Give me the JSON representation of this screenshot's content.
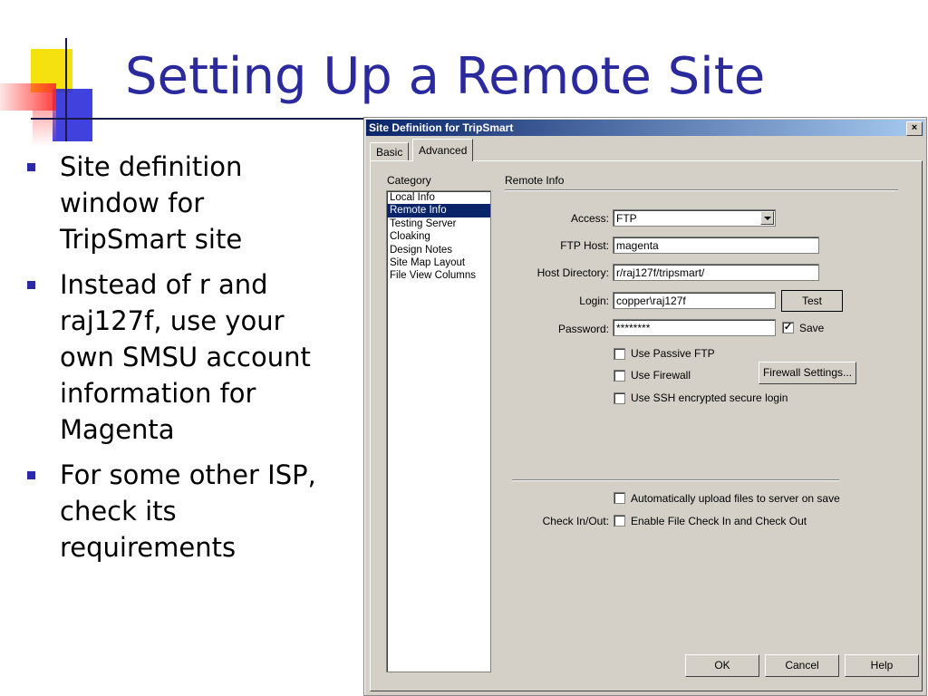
{
  "slide": {
    "title": "Setting Up a Remote Site",
    "bullets": [
      "Site definition window for TripSmart site",
      "Instead of r and raj127f, use your own SMSU account information for Magenta",
      "For some other ISP, check its requirements"
    ]
  },
  "dialog": {
    "title": "Site Definition for TripSmart",
    "close_label": "×",
    "tabs": [
      "Basic",
      "Advanced"
    ],
    "category_label": "Category",
    "categories": [
      "Local Info",
      "Remote Info",
      "Testing Server",
      "Cloaking",
      "Design Notes",
      "Site Map Layout",
      "File View Columns"
    ],
    "section_title": "Remote Info",
    "access_label": "Access:",
    "access_value": "FTP",
    "ftp_host_label": "FTP Host:",
    "ftp_host_value": "magenta",
    "host_dir_label": "Host Directory:",
    "host_dir_value": "r/raj127f/tripsmart/",
    "login_label": "Login:",
    "login_value": "copper\\raj127f",
    "test_button": "Test",
    "password_label": "Password:",
    "password_value": "********",
    "save_label": "Save",
    "save_checked": true,
    "passive_ftp_label": "Use Passive FTP",
    "passive_ftp_checked": false,
    "firewall_label": "Use Firewall",
    "firewall_checked": false,
    "firewall_settings_button": "Firewall Settings...",
    "ssh_label": "Use SSH encrypted secure login",
    "ssh_checked": false,
    "auto_upload_label": "Automatically upload files to server on save",
    "auto_upload_checked": false,
    "checkinout_label": "Check In/Out:",
    "checkinout_option_label": "Enable File Check In and Check Out",
    "checkinout_checked": false,
    "ok_button": "OK",
    "cancel_button": "Cancel",
    "help_button": "Help",
    "checkmark": "✓"
  },
  "colors": {
    "title": "#2a2a9e",
    "bullet": "#2a2aa8",
    "dialog_face": "#d4d0c8",
    "selection": "#0a246a"
  }
}
